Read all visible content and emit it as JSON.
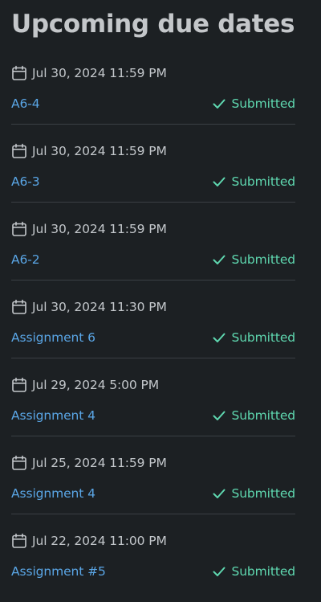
{
  "header": {
    "title": "Upcoming due dates"
  },
  "colors": {
    "background": "#1c2023",
    "link": "#5aa6e6",
    "status": "#5fd8b0",
    "divider": "#3a3f44"
  },
  "items": [
    {
      "date": "Jul 30, 2024 11:59 PM",
      "name": "A6-4",
      "status": "Submitted"
    },
    {
      "date": "Jul 30, 2024 11:59 PM",
      "name": "A6-3",
      "status": "Submitted"
    },
    {
      "date": "Jul 30, 2024 11:59 PM",
      "name": "A6-2",
      "status": "Submitted"
    },
    {
      "date": "Jul 30, 2024 11:30 PM",
      "name": "Assignment 6",
      "status": "Submitted"
    },
    {
      "date": "Jul 29, 2024 5:00 PM",
      "name": "Assignment 4",
      "status": "Submitted"
    },
    {
      "date": "Jul 25, 2024 11:59 PM",
      "name": "Assignment 4",
      "status": "Submitted"
    },
    {
      "date": "Jul 22, 2024 11:00 PM",
      "name": "Assignment #5",
      "status": "Submitted"
    }
  ],
  "icons": {
    "date": "calendar-icon",
    "status": "checkmark-icon"
  }
}
